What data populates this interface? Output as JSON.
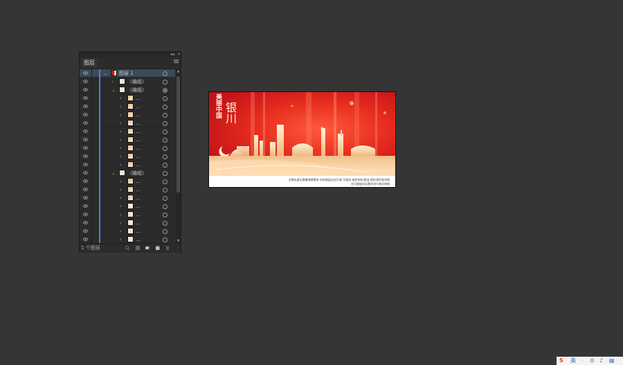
{
  "panel": {
    "tab_label": "图层",
    "collapse_glyph": "◂◂",
    "close_glyph": "×",
    "menu_icon": "hamburger-menu-icon",
    "footer_count": "1 个图层",
    "footer_icons": [
      "locate-object-icon",
      "make-clipping-mask-icon",
      "create-sublayer-icon",
      "new-layer-icon",
      "delete-layer-icon"
    ],
    "layers": [
      {
        "name": "图层 1",
        "level": 0,
        "expanded": true,
        "thumb": "flag",
        "target": "open",
        "selected": true
      },
      {
        "name": "〈编组〉",
        "level": 1,
        "expanded": false,
        "thumb": "blank",
        "target": "open"
      },
      {
        "name": "〈编组〉",
        "level": 1,
        "expanded": true,
        "thumb": "blank",
        "target": "filled"
      },
      {
        "name": "...",
        "level": 2,
        "expanded": false,
        "thumb": "img",
        "target": "open"
      },
      {
        "name": "...",
        "level": 2,
        "expanded": false,
        "thumb": "img",
        "target": "open"
      },
      {
        "name": "...",
        "level": 2,
        "expanded": false,
        "thumb": "img",
        "target": "open"
      },
      {
        "name": "...",
        "level": 2,
        "expanded": false,
        "thumb": "img",
        "target": "open"
      },
      {
        "name": "...",
        "level": 2,
        "expanded": false,
        "thumb": "img",
        "target": "open"
      },
      {
        "name": "...",
        "level": 2,
        "expanded": false,
        "thumb": "img",
        "target": "open"
      },
      {
        "name": "...",
        "level": 2,
        "expanded": false,
        "thumb": "img",
        "target": "open"
      },
      {
        "name": "...",
        "level": 2,
        "expanded": false,
        "thumb": "img",
        "target": "open"
      },
      {
        "name": "...",
        "level": 2,
        "expanded": false,
        "thumb": "img",
        "target": "open"
      },
      {
        "name": "〈编组〉",
        "level": 1,
        "expanded": true,
        "thumb": "blank",
        "target": "open"
      },
      {
        "name": "...",
        "level": 2,
        "expanded": false,
        "thumb": "img",
        "target": "open"
      },
      {
        "name": "...",
        "level": 2,
        "expanded": false,
        "thumb": "img",
        "target": "open"
      },
      {
        "name": "...",
        "level": 2,
        "expanded": false,
        "thumb": "img",
        "target": "open"
      },
      {
        "name": "...",
        "level": 2,
        "expanded": false,
        "thumb": "blank",
        "target": "open"
      },
      {
        "name": "...",
        "level": 2,
        "expanded": false,
        "thumb": "blank",
        "target": "open"
      },
      {
        "name": "...",
        "level": 2,
        "expanded": false,
        "thumb": "blank",
        "target": "open"
      },
      {
        "name": "...",
        "level": 2,
        "expanded": false,
        "thumb": "blank",
        "target": "open"
      },
      {
        "name": "...",
        "level": 2,
        "expanded": false,
        "thumb": "blank",
        "target": "open"
      },
      {
        "name": "...",
        "level": 2,
        "expanded": false,
        "thumb": "blank",
        "target": "open"
      }
    ]
  },
  "artboard": {
    "slogan": "美丽中国",
    "city": "银川",
    "caption_line1": "全稿矢量无需重建模素材 所有图层自由可调  可填充,缩合绘制,影变,图形调色复合图",
    "caption_line2": "也可根据实际需求进行格式转换",
    "colors": {
      "primary_red": "#d61f1f",
      "gold": "#f3d3a1"
    }
  },
  "tray": {
    "items": [
      "S",
      "英",
      "·",
      "⊙",
      "♪",
      "▤"
    ]
  }
}
